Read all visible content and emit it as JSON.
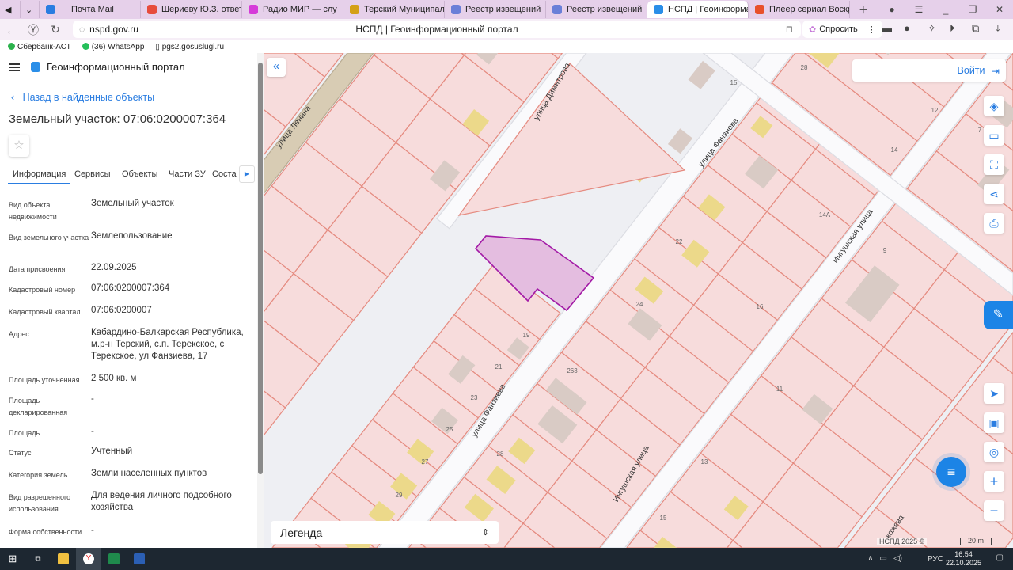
{
  "browser": {
    "tabs": [
      {
        "label": "Почта Mail",
        "color": "#2a7de1"
      },
      {
        "label": "Шериеву Ю.З. ответ на",
        "color": "#e74c3c"
      },
      {
        "label": "Радио МИР — слу",
        "color": "#d63ad9"
      },
      {
        "label": "Терский Муниципальны",
        "color": "#d4a017"
      },
      {
        "label": "Реестр извещений",
        "color": "#6a7fd8"
      },
      {
        "label": "Реестр извещений",
        "color": "#6a7fd8"
      },
      {
        "label": "НСПД | Геоинформац",
        "color": "#2a8ee8",
        "active": true
      },
      {
        "label": "Плеер сериал Воскреси",
        "color": "#e8502a"
      }
    ],
    "url": "nspd.gov.ru",
    "page_title": "НСПД | Геоинформационный портал",
    "ask_label": "Спросить",
    "bookmarks": [
      "Сбербанк-АСТ",
      "(36) WhatsApp",
      "pgs2.gosuslugi.ru"
    ]
  },
  "panel": {
    "app_title": "Геоинформационный портал",
    "back_link": "Назад в найденные объекты",
    "title": "Земельный участок: 07:06:0200007:364",
    "tabs": [
      "Информация",
      "Сервисы",
      "Объекты",
      "Части ЗУ",
      "Соста"
    ],
    "active_tab": "Информация",
    "fields": [
      {
        "label": "Вид объекта недвижимости",
        "value": "Земельный участок"
      },
      {
        "label": "Вид земельного участка",
        "value": "Землепользование"
      },
      {
        "label": "Дата присвоения",
        "value": "22.09.2025"
      },
      {
        "label": "Кадастровый номер",
        "value": "07:06:0200007:364"
      },
      {
        "label": "Кадастровый квартал",
        "value": "07:06:0200007"
      },
      {
        "label": "Адрес",
        "value": "Кабардино-Балкарская Республика, м.р-н Терский, с.п. Терекское, с Терекское, ул Фанзиева, 17"
      },
      {
        "label": "Площадь уточненная",
        "value": "2 500 кв. м"
      },
      {
        "label": "Площадь декларированная",
        "value": "-"
      },
      {
        "label": "Площадь",
        "value": "-"
      },
      {
        "label": "Статус",
        "value": "Учтенный"
      },
      {
        "label": "Категория земель",
        "value": "Земли населенных пунктов"
      },
      {
        "label": "Вид разрешенного использования",
        "value": "Для ведения личного подсобного хозяйства"
      },
      {
        "label": "Форма собственности",
        "value": "-"
      }
    ]
  },
  "map": {
    "login_label": "Войти",
    "legend_label": "Легенда",
    "attribution": "НСПД 2025 ©",
    "scale_label": "20 m",
    "selected_parcel_color": "#e4bde0",
    "parcel_color": "#f7dcdc",
    "streets": {
      "lenina": "улица Ленина",
      "dimitrova": "улица Димитрова",
      "fanzieva": "улица Фанзиева",
      "ingush": "Ингушская улица",
      "kozheva": "кожева"
    },
    "house_numbers": [
      "15",
      "28",
      "12",
      "7",
      "14",
      "14А",
      "9",
      "22",
      "16",
      "24",
      "19",
      "21",
      "263",
      "23",
      "25",
      "27",
      "28",
      "29",
      "11",
      "13",
      "15"
    ],
    "controls": [
      "layers-icon",
      "ruler-icon",
      "select-area-icon",
      "share-icon",
      "print-icon",
      "locate-icon",
      "minimap-icon",
      "geo-search-icon",
      "zoom-in-icon",
      "zoom-out-icon"
    ]
  },
  "taskbar": {
    "lang": "РУС",
    "time": "16:54",
    "date": "22.10.2025"
  }
}
